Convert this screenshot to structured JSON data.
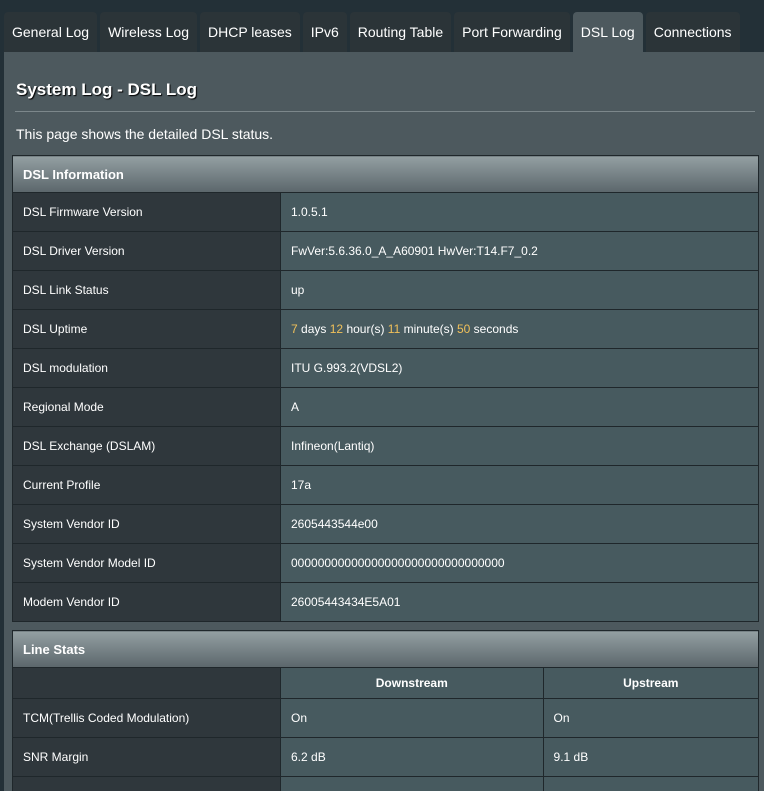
{
  "tabs": [
    "General Log",
    "Wireless Log",
    "DHCP leases",
    "IPv6",
    "Routing Table",
    "Port Forwarding",
    "DSL Log",
    "Connections"
  ],
  "active_tab": "DSL Log",
  "page": {
    "title": "System Log - DSL Log",
    "description": "This page shows the detailed DSL status."
  },
  "dsl_info": {
    "heading": "DSL Information",
    "rows": [
      {
        "label": "DSL Firmware Version",
        "value": "1.0.5.1"
      },
      {
        "label": "DSL Driver Version",
        "value": "FwVer:5.6.36.0_A_A60901 HwVer:T14.F7_0.2"
      },
      {
        "label": "DSL Link Status",
        "value": "up"
      },
      {
        "label": "DSL Uptime",
        "value": ""
      },
      {
        "label": "DSL modulation",
        "value": "ITU G.993.2(VDSL2)"
      },
      {
        "label": "Regional Mode",
        "value": "A"
      },
      {
        "label": "DSL Exchange (DSLAM)",
        "value": "Infineon(Lantiq)"
      },
      {
        "label": "Current Profile",
        "value": "17a"
      },
      {
        "label": "System Vendor ID",
        "value": "2605443544e00"
      },
      {
        "label": "System Vendor Model ID",
        "value": "00000000000000000000000000000000"
      },
      {
        "label": "Modem Vendor ID",
        "value": "26005443434E5A01"
      }
    ],
    "uptime": {
      "days": "7",
      "days_unit": "days",
      "hours": "12",
      "hours_unit": "hour(s)",
      "minutes": "11",
      "minutes_unit": "minute(s)",
      "seconds": "50",
      "seconds_unit": "seconds"
    }
  },
  "line_stats": {
    "heading": "Line Stats",
    "columns": [
      "Downstream",
      "Upstream"
    ],
    "rows": [
      {
        "label": "TCM(Trellis Coded Modulation)",
        "down": "On",
        "up": "On"
      },
      {
        "label": "SNR Margin",
        "down": "6.2 dB",
        "up": "9.1 dB"
      }
    ]
  },
  "colors": {
    "highlight": "#f0c05a",
    "panel": "#4d595e",
    "label_cell": "#2f373c",
    "value_cell": "#475a5f"
  }
}
